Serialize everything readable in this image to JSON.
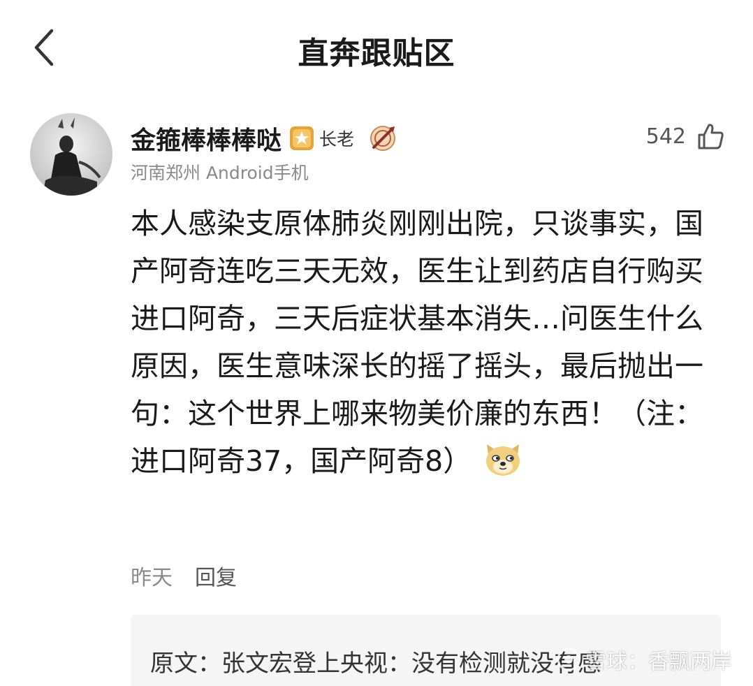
{
  "header": {
    "title": "直奔跟贴区",
    "back_icon": "chevron-left-icon"
  },
  "comment": {
    "author": {
      "name": "金箍棒棒棒哒",
      "rank_label": "长老",
      "rank_icon": "rank-badge-icon",
      "medal_icon": "medal-badge-icon",
      "location_device": "河南郑州 Android手机",
      "avatar_icon": "avatar"
    },
    "like_count": "542",
    "like_icon": "thumbs-up-icon",
    "body": "本人感染支原体肺炎刚刚出院，只谈事实，国产阿奇连吃三天无效，医生让到药店自行购买进口阿奇，三天后症状基本消失…问医生什么原因，医生意味深长的摇了摇头，最后抛出一句：这个世界上哪来物美价廉的东西！（注：进口阿奇37，国产阿奇8）",
    "emoji": "doge-emoji-icon",
    "timestamp": "昨天",
    "reply_label": "回复"
  },
  "quote": {
    "text": "原文：张文宏登上央视：没有检测就没有感"
  },
  "watermark": {
    "text": "雪球：香飘两岸"
  },
  "colors": {
    "title": "#1a1a1a",
    "meta": "#8a8a8a",
    "quote_bg": "#f5f5f5",
    "rank_badge": "#e8a23a"
  }
}
